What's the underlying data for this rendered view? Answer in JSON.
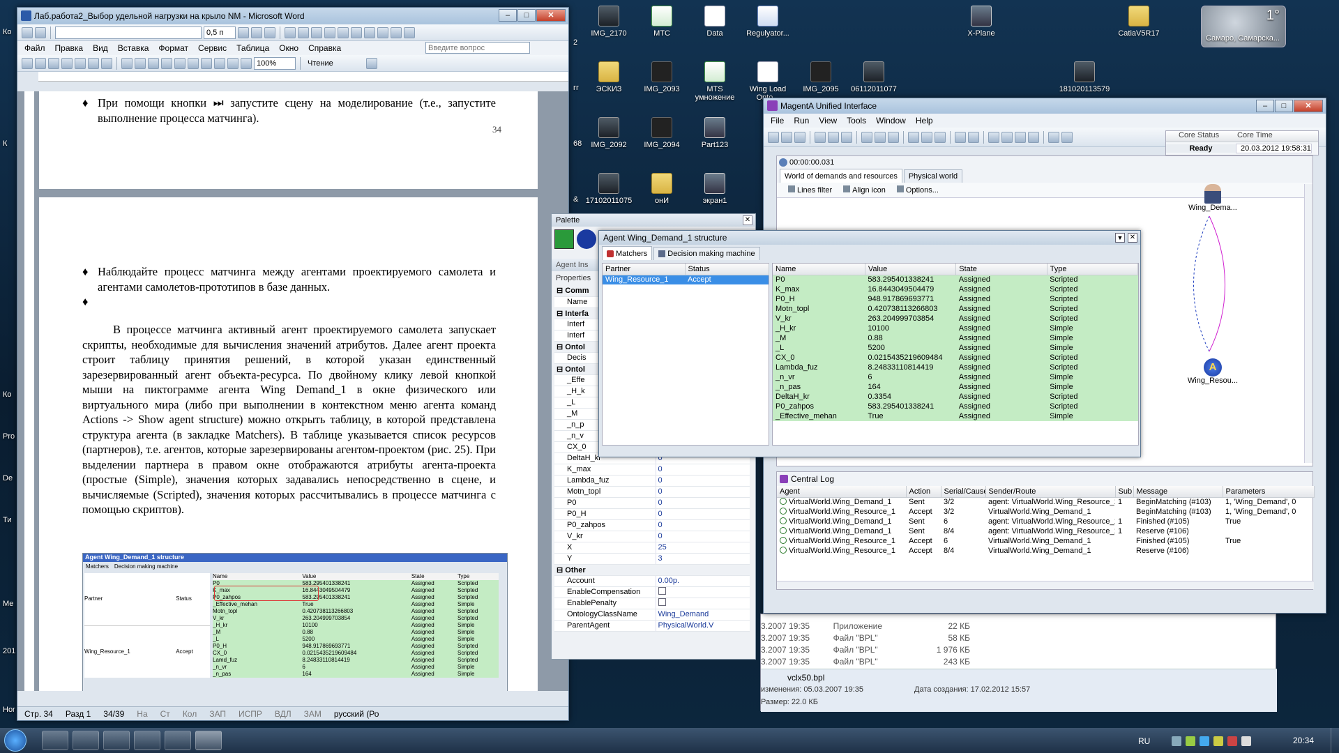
{
  "desktop": {
    "icons": [
      {
        "label": "IMG_2170",
        "kind": "img"
      },
      {
        "label": "МТС",
        "kind": "xls"
      },
      {
        "label": "Data",
        "kind": "doc"
      },
      {
        "label": "Regulyator...",
        "kind": "word"
      },
      {
        "label": "X-Plane",
        "kind": "app"
      },
      {
        "label": "CatiaV5R17",
        "kind": "folder"
      },
      {
        "label": "ЭСКИЗ",
        "kind": "folder"
      },
      {
        "label": "IMG_2093",
        "kind": "dark"
      },
      {
        "label": "MTS умножение",
        "kind": "xls"
      },
      {
        "label": "Wing Load Onto...",
        "kind": "doc"
      },
      {
        "label": "IMG_2095",
        "kind": "dark"
      },
      {
        "label": "06112011077",
        "kind": "img"
      },
      {
        "label": "181020113579",
        "kind": "img"
      },
      {
        "label": "IMG_2092",
        "kind": "img"
      },
      {
        "label": "IMG_2094",
        "kind": "dark"
      },
      {
        "label": "Part123",
        "kind": "app"
      },
      {
        "label": "17102011075",
        "kind": "img"
      },
      {
        "label": "онИ",
        "kind": "folder"
      },
      {
        "label": "экран1",
        "kind": "app"
      }
    ],
    "edge_labels": [
      "Ко",
      "2",
      "К",
      "гг",
      "68",
      "&",
      "Ко",
      "Pro",
      "De",
      "Ти",
      "Ме",
      "201",
      "Hor"
    ],
    "weather": {
      "temp": "1°",
      "location": "Самаро, Самарска..."
    }
  },
  "word": {
    "title": "Лаб.работа2_Выбор удельной нагрузки на крыло NM - Microsoft Word",
    "menu": [
      "Файл",
      "Правка",
      "Вид",
      "Вставка",
      "Формат",
      "Сервис",
      "Таблица",
      "Окно",
      "Справка"
    ],
    "line_width": "0,5 п",
    "help_placeholder": "Введите вопрос",
    "zoom": "100%",
    "reading_mode": "Чтение",
    "page1_bullet": "При помощи кнопки ⏭ запустите сцену на моделирование (т.е., запустите выполнение процесса матчинга).",
    "page_number": "34",
    "bullet1": "Наблюдайте процесс матчинга между агентами проектируемого самолета и агентами самолетов-прототипов в базе данных.",
    "paragraph": "В процессе матчинга активный агент проектируемого самолета запускает скрипты, необходимые для вычисления значений атрибутов. Далее агент проекта строит таблицу принятия решений, в которой указан единственный зарезервированный агент объекта-ресурса. По двойному клику левой кнопкой мыши на пиктограмме агента Wing Demand_1 в окне физического или виртуального мира (либо при выполнении в контекстном меню агента команд Actions -> Show agent structure) можно открыть таблицу, в которой представлена структура агента (в закладке Matchers). В таблице указывается список ресурсов (партнеров), т.е. агентов, которые зарезервированы агентом-проектом (рис. 25). При выделении партнера в правом окне отображаются атрибуты агента-проекта (простые (Simple), значения которых задавались непосредственно в сцене, и вычисляемые (Scripted), значения которых рассчитывались в процессе матчинга с помощью скриптов).",
    "figure": {
      "title": "Agent Wing_Demand_1 structure",
      "tabs": [
        "Matchers",
        "Decision making machine"
      ],
      "left_headers": [
        "Partner",
        "Status"
      ],
      "left_row": [
        "Wing_Resource_1",
        "Accept"
      ],
      "headers": [
        "Name",
        "Value",
        "State",
        "Type"
      ],
      "rows": [
        [
          "P0",
          "583.295401338241",
          "Assigned",
          "Scripted"
        ],
        [
          "K_max",
          "16.8443049504479",
          "Assigned",
          "Scripted"
        ],
        [
          "P0_zahpos",
          "583.295401338241",
          "Assigned",
          "Scripted"
        ],
        [
          "_Effective_mehan",
          "True",
          "Assigned",
          "Simple"
        ],
        [
          "Motn_topl",
          "0.420738113266803",
          "Assigned",
          "Scripted"
        ],
        [
          "V_kr",
          "263.204999703854",
          "Assigned",
          "Scripted"
        ],
        [
          "_H_kr",
          "10100",
          "Assigned",
          "Simple"
        ],
        [
          "_M",
          "0.88",
          "Assigned",
          "Simple"
        ],
        [
          "_L",
          "5200",
          "Assigned",
          "Simple"
        ],
        [
          "P0_H",
          "948.917869693771",
          "Assigned",
          "Scripted"
        ],
        [
          "CX_0",
          "0.0215435219609484",
          "Assigned",
          "Scripted"
        ],
        [
          "Lamd_fuz",
          "8.24833110814419",
          "Assigned",
          "Scripted"
        ],
        [
          "_n_vr",
          "6",
          "Assigned",
          "Simple"
        ],
        [
          "_n_pas",
          "164",
          "Assigned",
          "Simple"
        ]
      ]
    },
    "status": {
      "page": "Стр. 34",
      "section": "Разд 1",
      "pages": "34/39",
      "at": "На",
      "line": "Ст",
      "col": "Кол",
      "rec": "ЗАП",
      "trk": "ИСПР",
      "ext": "ВДЛ",
      "ovr": "ЗАМ",
      "lang": "русский (Ро"
    }
  },
  "palette": {
    "title": "Palette"
  },
  "inspector": {
    "title": "Agent Ins",
    "props_label": "Properties",
    "rows": [
      {
        "cat": true,
        "name": "Comm",
        "value": ""
      },
      {
        "name": "Name",
        "value": ""
      },
      {
        "cat": true,
        "name": "Interfa",
        "value": ""
      },
      {
        "name": "Interf",
        "value": ""
      },
      {
        "name": "Interf",
        "value": ""
      },
      {
        "cat": true,
        "name": "Ontol",
        "value": ""
      },
      {
        "name": "Decis",
        "value": ""
      },
      {
        "cat": true,
        "name": "Ontol",
        "value": ""
      },
      {
        "name": "_Effe",
        "value": ""
      },
      {
        "name": "_H_k",
        "value": ""
      },
      {
        "name": "_L",
        "value": ""
      },
      {
        "name": "_M",
        "value": ""
      },
      {
        "name": "_n_p",
        "value": ""
      },
      {
        "name": "_n_v",
        "value": ""
      },
      {
        "name": "CX_0",
        "value": "0"
      },
      {
        "name": "DeltaH_kr",
        "value": "0"
      },
      {
        "name": "K_max",
        "value": "0"
      },
      {
        "name": "Lambda_fuz",
        "value": "0"
      },
      {
        "name": "Motn_topl",
        "value": "0"
      },
      {
        "name": "P0",
        "value": "0"
      },
      {
        "name": "P0_H",
        "value": "0"
      },
      {
        "name": "P0_zahpos",
        "value": "0"
      },
      {
        "name": "V_kr",
        "value": "0"
      },
      {
        "name": "X",
        "value": "25"
      },
      {
        "name": "Y",
        "value": "3"
      },
      {
        "cat": true,
        "name": "Other",
        "value": ""
      },
      {
        "name": "Account",
        "value": "0.00р."
      },
      {
        "name": "EnableCompensation",
        "value": ""
      },
      {
        "name": "EnablePenalty",
        "value": ""
      },
      {
        "name": "OntologyClassName",
        "value": "Wing_Demand"
      },
      {
        "name": "ParentAgent",
        "value": "PhysicalWorld.V"
      }
    ]
  },
  "magenta": {
    "title": "MagentA Unified Interface",
    "menu": [
      "File",
      "Run",
      "View",
      "Tools",
      "Window",
      "Help"
    ],
    "core_status_label": "Core Status",
    "core_time_label": "Core Time",
    "core_status": "Ready",
    "core_time": "20.03.2012 19:58:31",
    "clock": "00:00:00.031",
    "tabs": [
      "World of demands and resources",
      "Physical world"
    ],
    "world_toolbar": [
      "Lines filter",
      "Align icon",
      "Options..."
    ],
    "agent_top": "Wing_Dema...",
    "agent_bottom": "Wing_Resou...",
    "agent_badge": "A",
    "log": {
      "title": "Central Log",
      "headers": [
        "Agent",
        "Action",
        "Serial/Causer",
        "Sender/Route",
        "Sub",
        "Message",
        "Parameters"
      ],
      "rows": [
        [
          "VirtualWorld.Wing_Demand_1",
          "Sent",
          "3/2",
          "agent: VirtualWorld.Wing_Resource_1",
          "1",
          "BeginMatching (#103)",
          "1, 'Wing_Demand', 0"
        ],
        [
          "VirtualWorld.Wing_Resource_1",
          "Accept",
          "3/2",
          "VirtualWorld.Wing_Demand_1",
          "",
          "BeginMatching (#103)",
          "1, 'Wing_Demand', 0"
        ],
        [
          "VirtualWorld.Wing_Demand_1",
          "Sent",
          "6",
          "agent: VirtualWorld.Wing_Resource_1",
          "1",
          "Finished (#105)",
          "True"
        ],
        [
          "VirtualWorld.Wing_Demand_1",
          "Sent",
          "8/4",
          "agent: VirtualWorld.Wing_Resource_1",
          "1",
          "Reserve (#106)",
          ""
        ],
        [
          "VirtualWorld.Wing_Resource_1",
          "Accept",
          "6",
          "VirtualWorld.Wing_Demand_1",
          "",
          "Finished (#105)",
          "True"
        ],
        [
          "VirtualWorld.Wing_Resource_1",
          "Accept",
          "8/4",
          "VirtualWorld.Wing_Demand_1",
          "",
          "Reserve (#106)",
          ""
        ]
      ]
    }
  },
  "structure": {
    "title": "Agent Wing_Demand_1 structure",
    "tabs": [
      "Matchers",
      "Decision making machine"
    ],
    "left_headers": [
      "Partner",
      "Status"
    ],
    "left_row": [
      "Wing_Resource_1",
      "Accept"
    ],
    "headers": [
      "Name",
      "Value",
      "State",
      "Type"
    ],
    "rows": [
      [
        "P0",
        "583.295401338241",
        "Assigned",
        "Scripted"
      ],
      [
        "K_max",
        "16.8443049504479",
        "Assigned",
        "Scripted"
      ],
      [
        "P0_H",
        "948.917869693771",
        "Assigned",
        "Scripted"
      ],
      [
        "Motn_topl",
        "0.420738113266803",
        "Assigned",
        "Scripted"
      ],
      [
        "V_kr",
        "263.204999703854",
        "Assigned",
        "Scripted"
      ],
      [
        "_H_kr",
        "10100",
        "Assigned",
        "Simple"
      ],
      [
        "_M",
        "0.88",
        "Assigned",
        "Simple"
      ],
      [
        "_L",
        "5200",
        "Assigned",
        "Simple"
      ],
      [
        "CX_0",
        "0.0215435219609484",
        "Assigned",
        "Scripted"
      ],
      [
        "Lambda_fuz",
        "8.24833110814419",
        "Assigned",
        "Scripted"
      ],
      [
        "_n_vr",
        "6",
        "Assigned",
        "Simple"
      ],
      [
        "_n_pas",
        "164",
        "Assigned",
        "Simple"
      ],
      [
        "DeltaH_kr",
        "0.3354",
        "Assigned",
        "Scripted"
      ],
      [
        "P0_zahpos",
        "583.295401338241",
        "Assigned",
        "Scripted"
      ],
      [
        "_Effective_mehan",
        "True",
        "Assigned",
        "Simple"
      ]
    ]
  },
  "explorer": {
    "rows": [
      [
        "3.2007 19:35",
        "Приложение",
        "22 КБ"
      ],
      [
        "3.2007 19:35",
        "Файл \"BPL\"",
        "58 КБ"
      ],
      [
        "3.2007 19:35",
        "Файл \"BPL\"",
        "1 976 КБ"
      ],
      [
        "3.2007 19:35",
        "Файл \"BPL\"",
        "243 КБ"
      ]
    ],
    "file_name": "vclx50.bpl",
    "modified": "изменения: 05.03.2007 19:35",
    "created": "Дата создания: 17.02.2012 15:57",
    "size": "Размер: 22.0 КБ"
  },
  "taskbar": {
    "lang": "RU",
    "time": "20:34"
  }
}
